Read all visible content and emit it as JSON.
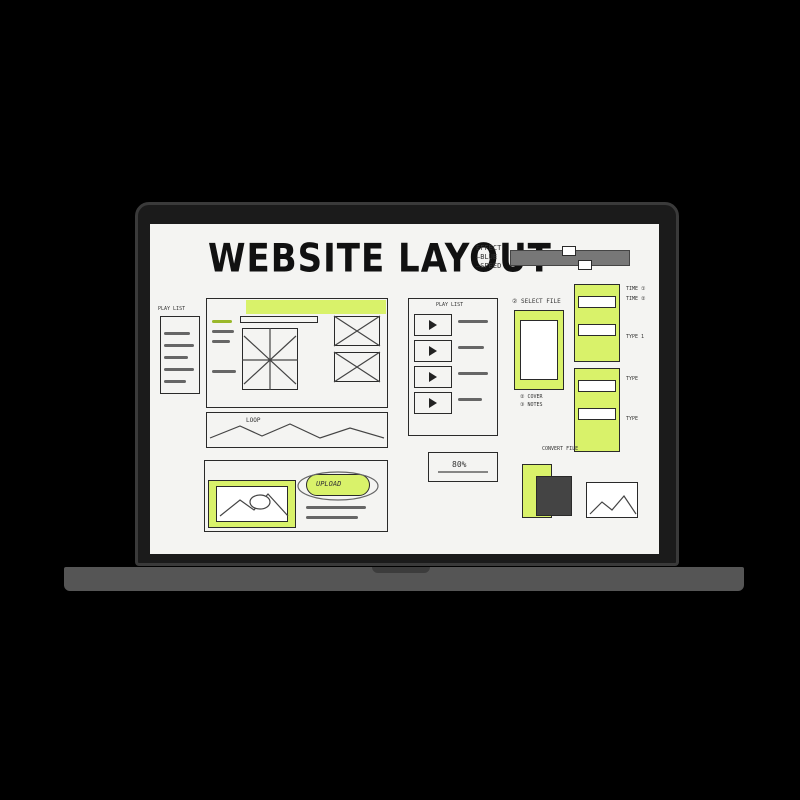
{
  "sketch": {
    "title": "WEBSITE LAYOUT",
    "corner_note": [
      "EFFECT",
      "—BLUE",
      "—SPEED"
    ],
    "play_list_label": "PLAY LIST",
    "select_file_label": "② SELECT FILE",
    "upload_label": "UPLOAD",
    "percent_label": "80%",
    "loop_label": "LOOP",
    "side_notes": [
      "TIME ①",
      "TIME ②",
      "TYPE 1",
      "TYPE",
      "TYPE"
    ],
    "left_label": "PLAY LIST",
    "convert_label": "CONVERT FILE",
    "color_notes": [
      "② COVER",
      "③ NOTES"
    ]
  },
  "colors": {
    "accent": "#d9f26a",
    "ink": "#222222",
    "paper": "#f4f4f2",
    "bezel": "#1b1b1b"
  }
}
